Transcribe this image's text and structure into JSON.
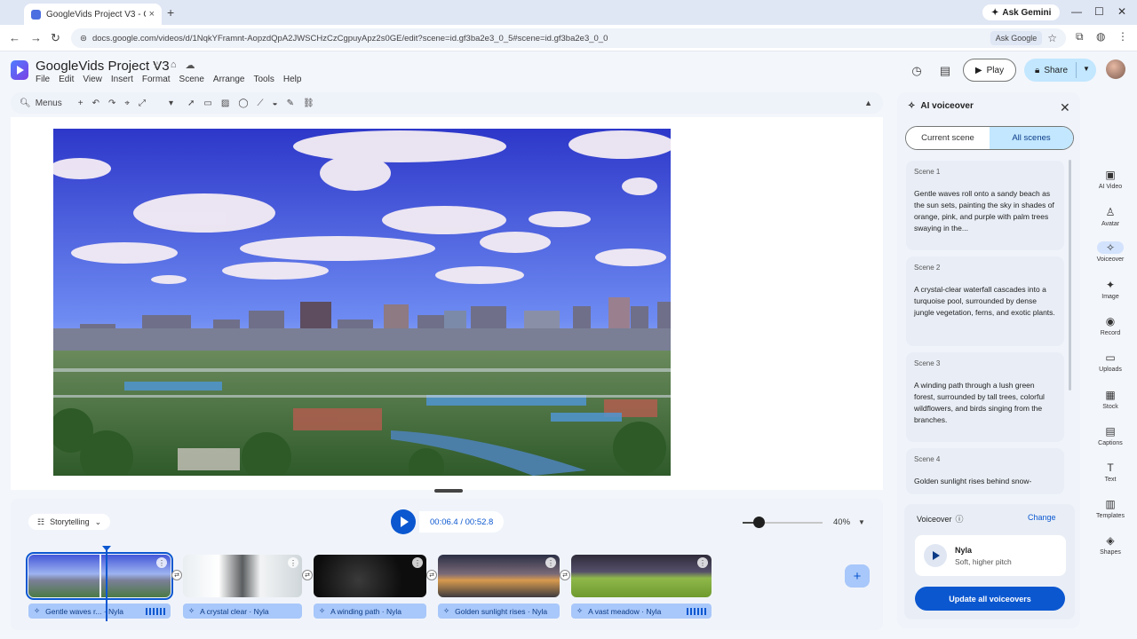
{
  "browser": {
    "tab_title": "GoogleVids Project V3 - G...",
    "tab_close": "×",
    "new_tab": "+",
    "ask_gemini": "Ask Gemini",
    "url": "docs.google.com/videos/d/1NqkYFramnt-AopzdQpA2JWSCHzCzCgpuyApz2s0GE/edit?scene=id.gf3ba2e3_0_5#scene=id.gf3ba2e3_0_0",
    "ask_google": "Ask Google",
    "icons": [
      "back-icon",
      "forward-icon",
      "reload-icon",
      "site-info-icon",
      "star-icon",
      "extensions-icon",
      "profile-icon",
      "kebab-icon"
    ]
  },
  "app": {
    "title": "GoogleVids Project V3",
    "menu": [
      "File",
      "Edit",
      "View",
      "Insert",
      "Format",
      "Scene",
      "Arrange",
      "Tools",
      "Help"
    ],
    "play_label": "Play",
    "share_label": "Share"
  },
  "toolbar": {
    "menus_label": "Menus"
  },
  "timeline": {
    "storytelling_label": "Storytelling",
    "timecode": "00:06.4 / 00:52.8",
    "zoom": "40%",
    "zoom_level": 0.2,
    "clips": [
      {
        "voiceover": "Gentle waves r... · Nyla"
      },
      {
        "voiceover": "A crystal clear · Nyla"
      },
      {
        "voiceover": "A winding path · Nyla"
      },
      {
        "voiceover": "Golden sunlight rises · Nyla"
      },
      {
        "voiceover": "A vast meadow · Nyla"
      }
    ],
    "add_label": "+"
  },
  "panel": {
    "title": "AI voiceover",
    "tab_current": "Current scene",
    "tab_all": "All scenes",
    "scenes": [
      {
        "heading": "Scene 1",
        "text": "Gentle waves roll onto a sandy beach as the sun sets, painting the sky in shades of orange, pink, and purple with palm trees swaying in the..."
      },
      {
        "heading": "Scene 2",
        "text": "A crystal-clear waterfall cascades into a turquoise pool, surrounded by dense jungle vegetation, ferns, and exotic plants."
      },
      {
        "heading": "Scene 3",
        "text": "A winding path through a lush green forest, surrounded by tall trees, colorful wildflowers, and birds singing from the branches."
      },
      {
        "heading": "Scene 4",
        "text": "Golden sunlight rises behind snow-"
      }
    ],
    "voiceover_label": "Voiceover",
    "change_label": "Change",
    "voice_name": "Nyla",
    "voice_desc": "Soft, higher pitch",
    "update_label": "Update all voiceovers"
  },
  "rail": [
    {
      "label": "AI Video",
      "icon": "ai-video-icon",
      "glyph": "▣"
    },
    {
      "label": "Avatar",
      "icon": "avatar-icon",
      "glyph": "♙"
    },
    {
      "label": "Voiceover",
      "icon": "voiceover-icon",
      "glyph": "✧"
    },
    {
      "label": "Image",
      "icon": "image-spark-icon",
      "glyph": "✦"
    },
    {
      "label": "Record",
      "icon": "record-icon",
      "glyph": "◉"
    },
    {
      "label": "Uploads",
      "icon": "uploads-icon",
      "glyph": "▭"
    },
    {
      "label": "Stock",
      "icon": "stock-icon",
      "glyph": "▦"
    },
    {
      "label": "Captions",
      "icon": "captions-icon",
      "glyph": "▤"
    },
    {
      "label": "Text",
      "icon": "text-icon",
      "glyph": "T"
    },
    {
      "label": "Templates",
      "icon": "templates-icon",
      "glyph": "▥"
    },
    {
      "label": "Shapes",
      "icon": "shapes-icon",
      "glyph": "◈"
    }
  ],
  "colors": {
    "accent": "#0b57d0",
    "share_bg": "#c2e7ff",
    "voiceover_chip": "#a8c7fa"
  }
}
